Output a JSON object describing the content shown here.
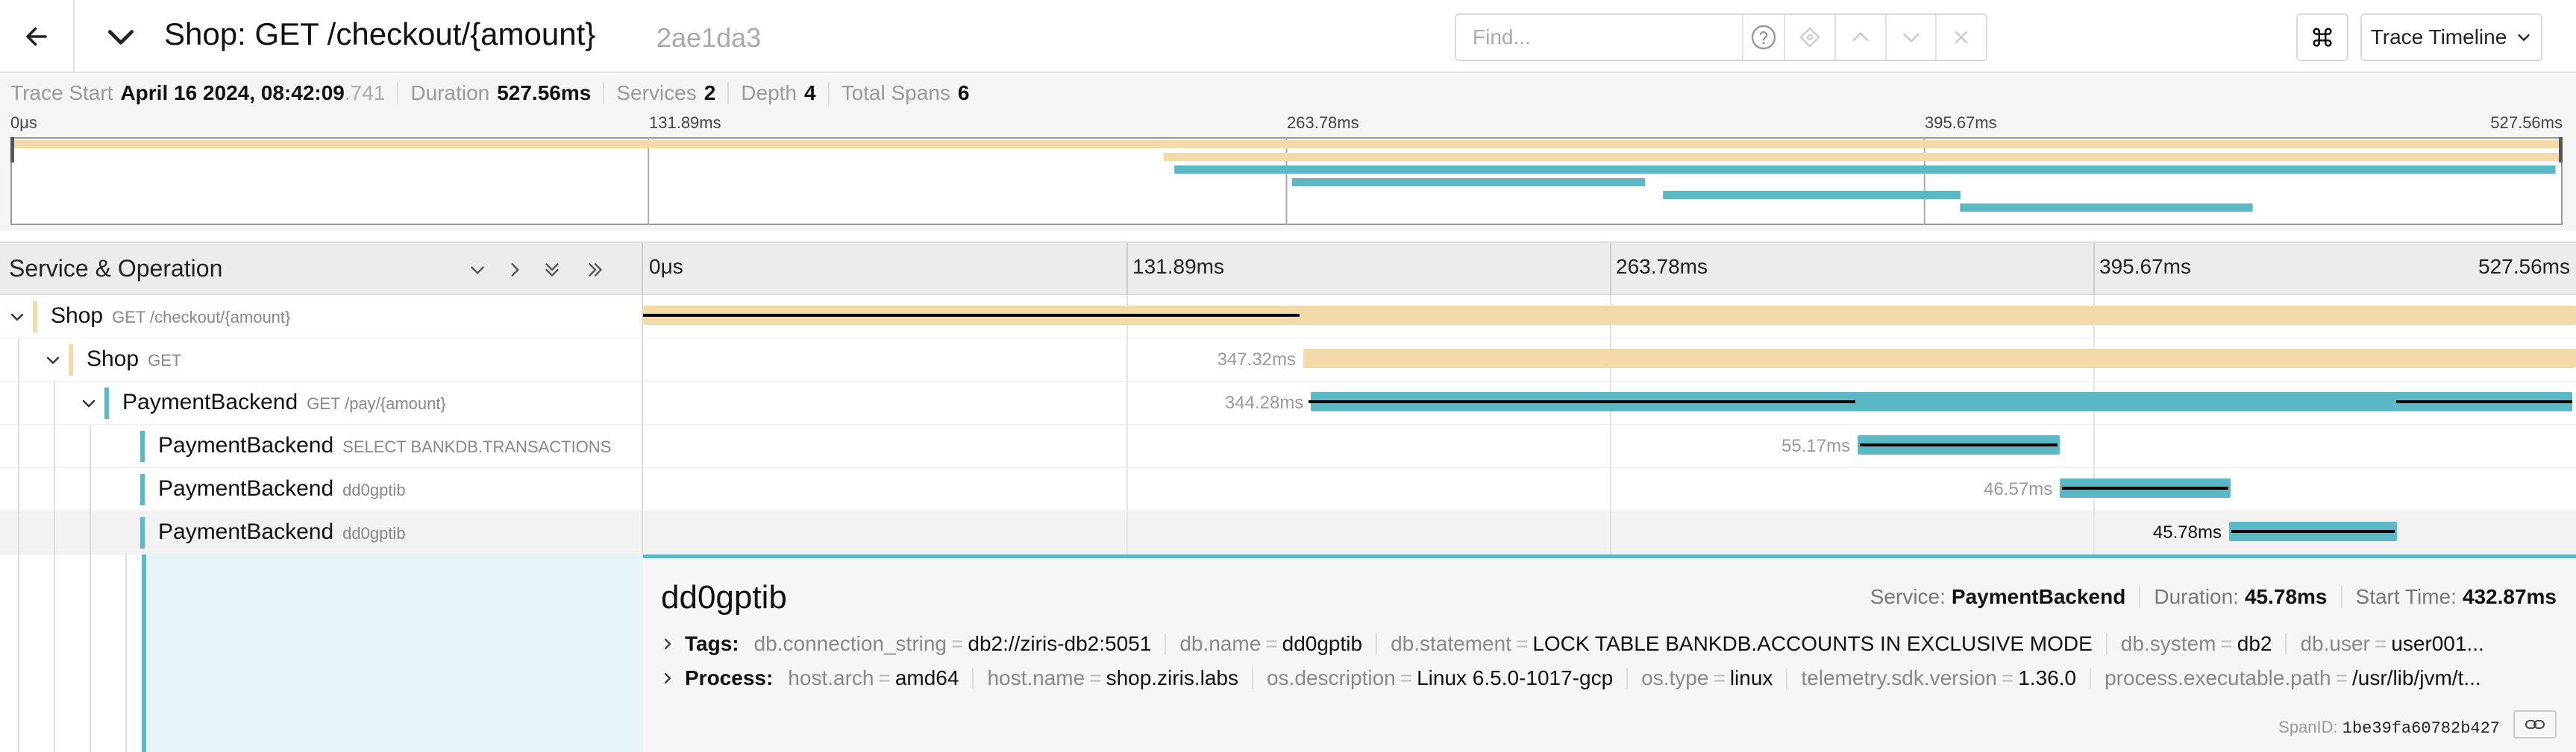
{
  "header": {
    "title": "Shop: GET /checkout/{amount}",
    "trace_id": "2ae1da3",
    "find_placeholder": "Find...",
    "view_label": "Trace Timeline"
  },
  "summary": {
    "trace_start_label": "Trace Start",
    "trace_start_value": "April 16 2024, 08:42:09",
    "trace_start_ms": ".741",
    "duration_label": "Duration",
    "duration_value": "527.56ms",
    "services_label": "Services",
    "services_value": "2",
    "depth_label": "Depth",
    "depth_value": "4",
    "total_spans_label": "Total Spans",
    "total_spans_value": "6"
  },
  "minimap": {
    "ticks": [
      "0μs",
      "131.89ms",
      "263.78ms",
      "395.67ms",
      "527.56ms"
    ],
    "total_ms": 527.56,
    "spans": [
      {
        "start_ms": 0,
        "dur_ms": 527.56,
        "color": "#f2dba8"
      },
      {
        "start_ms": 238.35,
        "dur_ms": 289.0,
        "color": "#f2dba8"
      },
      {
        "start_ms": 240.6,
        "dur_ms": 285.5,
        "color": "#5ab9c4"
      },
      {
        "start_ms": 264.9,
        "dur_ms": 73.0,
        "color": "#5ab9c4"
      },
      {
        "start_ms": 341.6,
        "dur_ms": 61.5,
        "color": "#5ab9c4"
      },
      {
        "start_ms": 403.0,
        "dur_ms": 60.5,
        "color": "#5ab9c4"
      }
    ]
  },
  "columns": {
    "title": "Service & Operation",
    "ticks": [
      "0μs",
      "131.89ms",
      "263.78ms",
      "395.67ms",
      "527.56ms"
    ]
  },
  "colors": {
    "shop": "#f2dba8",
    "payment": "#5ab9c4"
  },
  "rows": [
    {
      "service": "Shop",
      "operation": "GET /checkout/{amount}",
      "duration": "",
      "start_ms": 0,
      "dur_ms": 527.56,
      "color": "#f2dba8"
    },
    {
      "service": "Shop",
      "operation": "GET",
      "duration": "347.32ms",
      "start_ms": 180.2,
      "dur_ms": 347.32,
      "color": "#f2dba8"
    },
    {
      "service": "PaymentBackend",
      "operation": "GET /pay/{amount}",
      "duration": "344.28ms",
      "start_ms": 182.3,
      "dur_ms": 344.28,
      "color": "#5ab9c4"
    },
    {
      "service": "PaymentBackend",
      "operation": "SELECT BANKDB.TRANSACTIONS",
      "duration": "55.17ms",
      "start_ms": 331.5,
      "dur_ms": 55.17,
      "color": "#5ab9c4"
    },
    {
      "service": "PaymentBackend",
      "operation": "dd0gptib",
      "duration": "46.57ms",
      "start_ms": 386.7,
      "dur_ms": 46.57,
      "color": "#5ab9c4"
    },
    {
      "service": "PaymentBackend",
      "operation": "dd0gptib",
      "duration": "45.78ms",
      "start_ms": 432.87,
      "dur_ms": 45.78,
      "color": "#5ab9c4"
    }
  ],
  "detail": {
    "title": "dd0gptib",
    "service_label": "Service:",
    "service_value": "PaymentBackend",
    "duration_label": "Duration:",
    "duration_value": "45.78ms",
    "start_label": "Start Time:",
    "start_value": "432.87ms",
    "tags_label": "Tags:",
    "tags": [
      {
        "k": "db.connection_string",
        "v": "db2://ziris-db2:5051"
      },
      {
        "k": "db.name",
        "v": "dd0gptib"
      },
      {
        "k": "db.statement",
        "v": "LOCK TABLE BANKDB.ACCOUNTS IN EXCLUSIVE MODE"
      },
      {
        "k": "db.system",
        "v": "db2"
      },
      {
        "k": "db.user",
        "v": "user001..."
      }
    ],
    "process_label": "Process:",
    "process": [
      {
        "k": "host.arch",
        "v": "amd64"
      },
      {
        "k": "host.name",
        "v": "shop.ziris.labs"
      },
      {
        "k": "os.description",
        "v": "Linux 6.5.0-1017-gcp"
      },
      {
        "k": "os.type",
        "v": "linux"
      },
      {
        "k": "telemetry.sdk.version",
        "v": "1.36.0"
      },
      {
        "k": "process.executable.path",
        "v": "/usr/lib/jvm/t..."
      }
    ],
    "span_id_label": "SpanID:",
    "span_id_value": "1be39fa60782b427"
  }
}
